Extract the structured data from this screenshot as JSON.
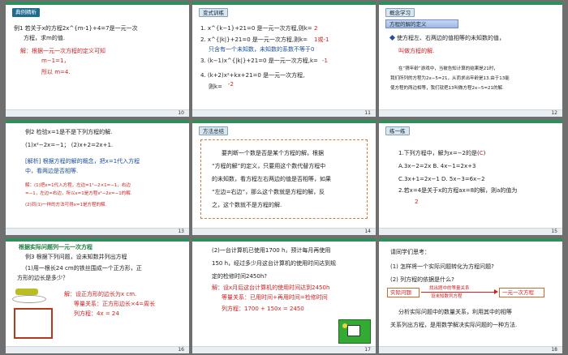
{
  "slides": [
    {
      "number": "10",
      "tag": "典例精析",
      "lines": [
        "例1  若关于x的方程2x^{m-1}+4=7是一元一次",
        "方程，求m的值.",
        "解：根据一元一次方程的定义可知",
        "m−1=1，",
        "所以  m=4."
      ]
    },
    {
      "number": "11",
      "tag": "变式训练",
      "lines": [
        "1. x^{k−1}+21=0  是一元一次方程,则k=",
        "2",
        "2. x^{|k|}+21=0  是一元一次方程,则k=",
        "1或-1",
        "只含有一个未知数，未知数的系数不等于0",
        "3. (k−1)x^{|k|}+21=0  是一元一次方程,k=",
        "-1",
        "4. (k+2)x²+kx+21=0  是一元一次方程,",
        "则k=",
        "-2"
      ]
    },
    {
      "number": "12",
      "tag": "概念学习",
      "subtitle": "方程的解的定义",
      "lines": [
        "使方程左、右两边的值相等的未知数的值，",
        "叫做方程的解.",
        "在“猜年龄”游戏中，当被告知计算的结果是21时，",
        "我们所列的方程为2x−5=21，从而求出年龄是13.由于13能",
        "使方程的两边相等，我们就把13叫做方程2x−5=21的解."
      ]
    },
    {
      "number": "13",
      "tag": "例2",
      "lines": [
        "例2  检验x=1是不是下列方程的解.",
        "(1)x²−2x=−1；       (2)x+2=2x+1.",
        "[解析] 根据方程的解的概念，把x=1代入方程",
        "中，看两边是否相等.",
        "解：(1)把x=1代入方程，左边=1²−2×1=−1，右边",
        "=−1，左边=右边，所以x=1是方程x²−2x=−1的解.",
        "(2)同(1)一样的方法可得x=1是方程的解."
      ]
    },
    {
      "number": "14",
      "tag": "方法总结",
      "lines": [
        "要判断一个数是否是某个方程的解，根据",
        "“方程的解”的定义，只要用这个数代替方程中",
        "的未知数，看方程左右两边的值是否相等，如果",
        "“左边=右边”，那么这个数就是方程的解，反",
        "之，这个数就不是方程的解."
      ]
    },
    {
      "number": "15",
      "tag": "练一练",
      "lines": [
        "1.下列方程中，解为x=−2的是(",
        "C",
        ")",
        "A.3x−2=2x        B. 4x−1=2x+3",
        "C.3x+1=2x−1     D. 5x−3=6x−2",
        "2.若x=4是关于x的方程ax=8的解，则a的值为",
        "2"
      ]
    },
    {
      "number": "16",
      "tag": "根据实际问题列一元一次方程",
      "lines": [
        "例3  根据下列问题，设未知数并列出方程",
        "(1)用一根长24 cm的铁丝围成一个正方形，正",
        "方形的边长是多少？",
        "解：设正方形的边长为x cm.",
        "等量关系：正方形边长×4=周长",
        "列方程：",
        "4x = 24"
      ]
    },
    {
      "number": "17",
      "tag": "",
      "lines": [
        "(2)一台计算机已使用1700 h，预计每月再使用",
        "150 h，经过多少月这台计算机的使用时间达到规",
        "定的检修时间2450h?",
        "解：设x月后这台计算机的使用时间达到2450h",
        "等量关系：已用时间+再用时间=检修时间",
        "列方程：1700 + 150x = 2450"
      ]
    },
    {
      "number": "18",
      "tag": "",
      "lines": [
        "请同学们思考：",
        "(1) 怎样将一个实际问题转化为方程问题?",
        "(2) 列方程的依据是什么?",
        "实际问题",
        "一元一次方程",
        "找出题中的等量关系",
        "设未知数列方程",
        "分析实际问题中的数量关系，利用其中的相等",
        "关系列出方程，是用数学解决实际问题的一种方法."
      ]
    }
  ]
}
